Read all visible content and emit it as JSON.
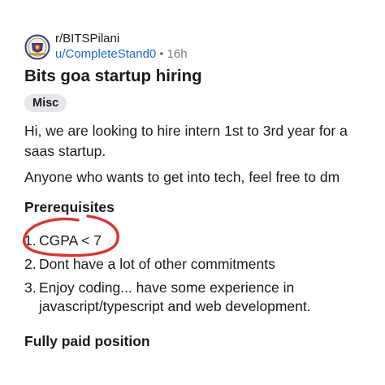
{
  "post": {
    "subreddit": "r/BITSPilani",
    "author": "u/CompleteStand0",
    "separator": "•",
    "age": "16h",
    "title": "Bits goa startup hiring",
    "flair": "Misc",
    "paragraphs": [
      "Hi, we are looking to hire intern 1st to 3rd year for a saas startup.",
      "Anyone who wants to get into tech, feel free to dm"
    ],
    "prerequisites_heading": "Prerequisites",
    "prerequisites": [
      {
        "number": "1.",
        "text": "CGPA < 7"
      },
      {
        "number": "2.",
        "text": "Dont have a lot of other commitments"
      },
      {
        "number": "3.",
        "text": "Enjoy coding... have some experience in javascript/typescript and web development."
      }
    ],
    "closing_heading": "Fully paid position"
  },
  "colors": {
    "text": "#1a1a1b",
    "username": "#1f66c9",
    "muted": "#7c7c7c",
    "flair_bg": "#e4e6ea",
    "annotation_circle": "#e0312c"
  },
  "icons": {
    "avatar": "subreddit-avatar-icon"
  }
}
